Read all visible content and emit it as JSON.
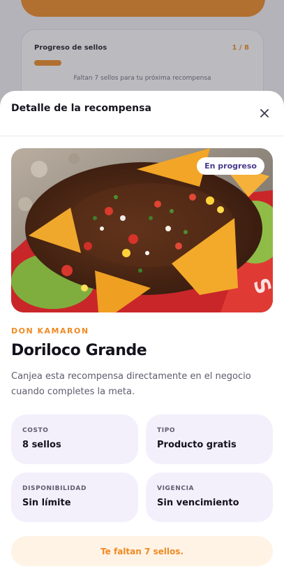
{
  "background": {
    "progress_title": "Progreso de sellos",
    "progress_count": "1 / 8",
    "progress_fraction": 0.125,
    "progress_note": "Faltan 7 sellos para tu próxima recompensa"
  },
  "sheet": {
    "title": "Detalle de la recompensa",
    "close_icon": "close-icon"
  },
  "reward": {
    "status_badge": "En progreso",
    "business": "DON KAMARON",
    "title": "Doriloco Grande",
    "description": "Canjea esta recompensa directamente en el negocio cuando completes la meta.",
    "image_subject": "doriloco-food-photo"
  },
  "details": [
    {
      "label": "COSTO",
      "value": "8 sellos"
    },
    {
      "label": "TIPO",
      "value": "Producto gratis"
    },
    {
      "label": "DISPONIBILIDAD",
      "value": "Sin límite"
    },
    {
      "label": "VIGENCIA",
      "value": "Sin vencimiento"
    }
  ],
  "cta": {
    "label": "Te faltan 7 sellos."
  },
  "colors": {
    "accent": "#f08a24",
    "badge_text": "#4a3a8c",
    "card_bg": "#f3f0fc",
    "cta_bg": "#fef3e5"
  }
}
